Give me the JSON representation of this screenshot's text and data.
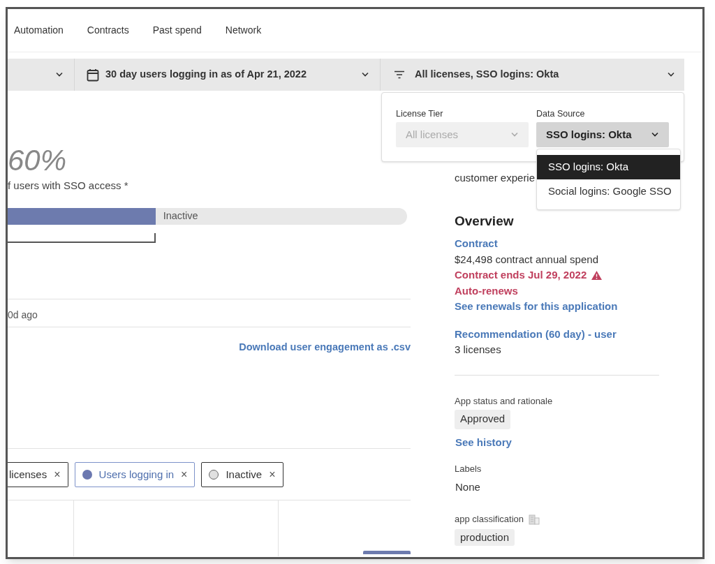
{
  "tabs": [
    {
      "label": "Automation"
    },
    {
      "label": "Contracts"
    },
    {
      "label": "Past spend"
    },
    {
      "label": "Network"
    }
  ],
  "filter_bar": {
    "segments": [
      {
        "kind": "blank"
      },
      {
        "kind": "date",
        "label": "30 day users logging in as of Apr 21, 2022"
      },
      {
        "kind": "filter",
        "label": "All licenses, SSO logins: Okta"
      }
    ]
  },
  "usage": {
    "percent": "60%",
    "caption": "f users with SSO access *",
    "bar": {
      "level": 0.37,
      "label": "Inactive"
    },
    "last_seen": "0d ago",
    "download_link": "Download user engagement as .csv",
    "chips": [
      {
        "kind": "plain",
        "label": "licenses",
        "close": "×",
        "active": false
      },
      {
        "kind": "filled",
        "label": "Users logging in",
        "close": "×",
        "active": true,
        "color": "#6b78b0"
      },
      {
        "kind": "hollow",
        "label": "Inactive",
        "close": "×",
        "active": false,
        "color": "#e0e0e0"
      }
    ]
  },
  "filter_popup": {
    "fields": [
      {
        "label": "License Tier",
        "value": "All licenses",
        "disabled": true
      },
      {
        "label": "Data Source",
        "value": "SSO logins: Okta",
        "disabled": false
      }
    ],
    "options": [
      {
        "label": "SSO logins: Okta",
        "selected": true
      },
      {
        "label": "Social logins: Google SSO",
        "selected": false
      }
    ]
  },
  "sidebar": {
    "description": [
      "customer experie"
    ],
    "overview": {
      "title": "Overview",
      "groups": [
        [
          {
            "kind": "link",
            "text": "Contract"
          },
          {
            "kind": "text",
            "text": "$24,498 contract annual spend"
          },
          {
            "kind": "alert",
            "text": "Contract ends Jul 29, 2022",
            "warning": true
          },
          {
            "kind": "alert",
            "text": "Auto-renews",
            "warning": false
          },
          {
            "kind": "link",
            "text": "See renewals for this application"
          }
        ],
        [
          {
            "kind": "link",
            "text": "Recommendation (60 day) - user"
          },
          {
            "kind": "text",
            "text": "3 licenses"
          }
        ]
      ]
    },
    "status": {
      "label": "App status and rationale",
      "value": "Approved",
      "link": "See history"
    },
    "labels": {
      "label": "Labels",
      "value": "None"
    },
    "classification": {
      "label": "app classification",
      "value": "production"
    }
  }
}
